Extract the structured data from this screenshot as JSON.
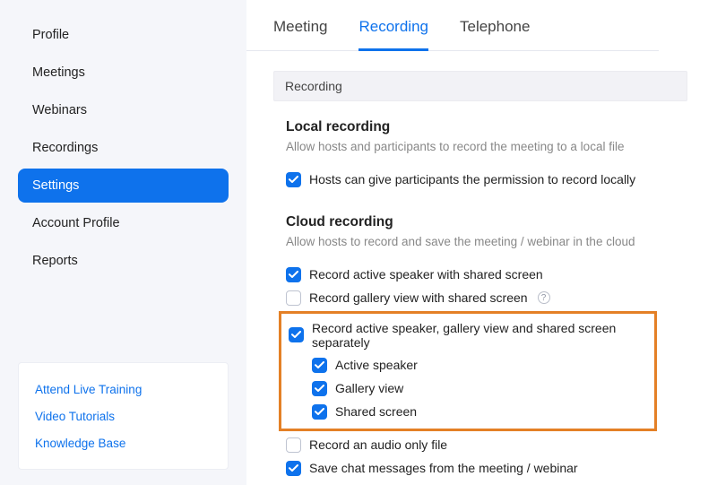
{
  "sidebar": {
    "items": [
      {
        "label": "Profile"
      },
      {
        "label": "Meetings"
      },
      {
        "label": "Webinars"
      },
      {
        "label": "Recordings"
      },
      {
        "label": "Settings"
      },
      {
        "label": "Account Profile"
      },
      {
        "label": "Reports"
      }
    ],
    "help": [
      {
        "label": "Attend Live Training"
      },
      {
        "label": "Video Tutorials"
      },
      {
        "label": "Knowledge Base"
      }
    ]
  },
  "tabs": [
    {
      "label": "Meeting"
    },
    {
      "label": "Recording"
    },
    {
      "label": "Telephone"
    }
  ],
  "band": {
    "label": "Recording"
  },
  "local": {
    "title": "Local recording",
    "desc": "Allow hosts and participants to record the meeting to a local file",
    "opt1": "Hosts can give participants the permission to record locally"
  },
  "cloud": {
    "title": "Cloud recording",
    "desc": "Allow hosts to record and save the meeting / webinar in the cloud",
    "opt1": "Record active speaker with shared screen",
    "opt2": "Record gallery view with shared screen",
    "opt3": "Record active speaker, gallery view and shared screen separately",
    "sub1": "Active speaker",
    "sub2": "Gallery view",
    "sub3": "Shared screen",
    "opt4": "Record an audio only file",
    "opt5": "Save chat messages from the meeting / webinar"
  }
}
